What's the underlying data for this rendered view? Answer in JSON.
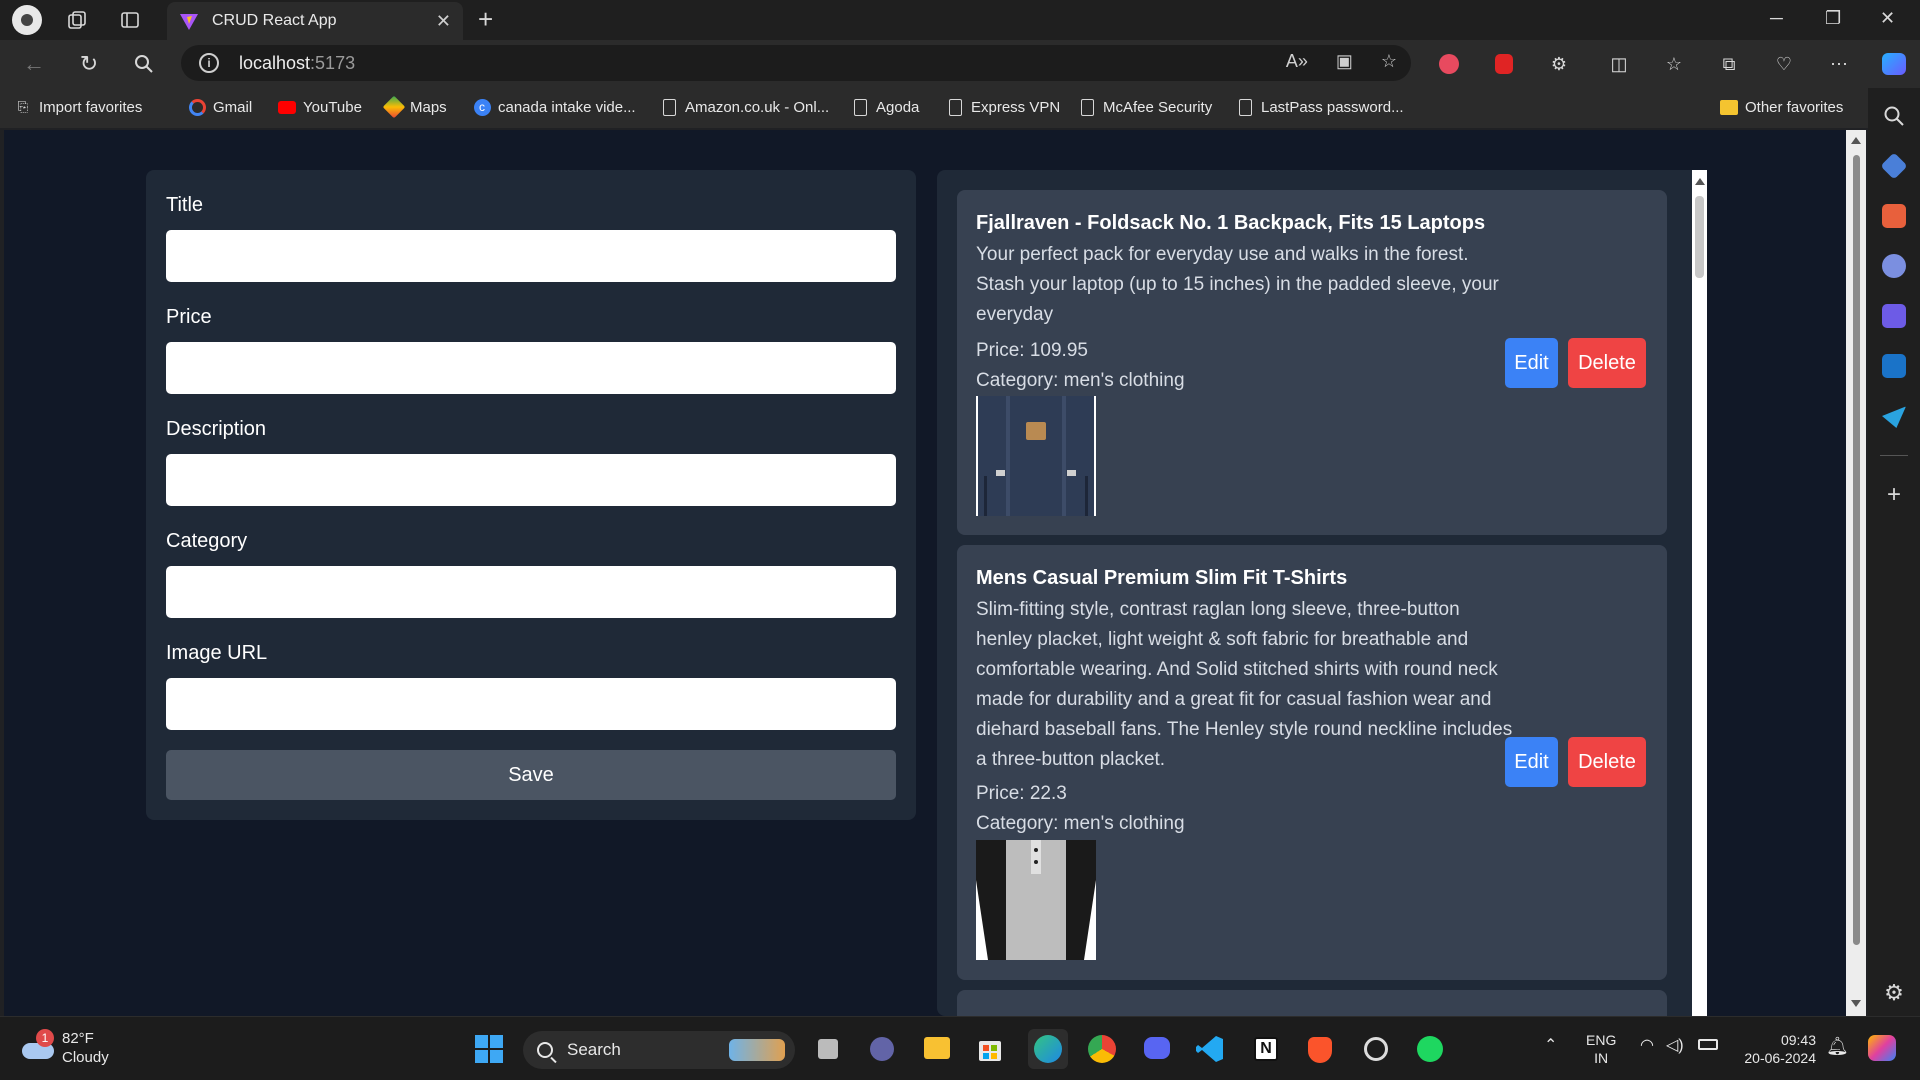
{
  "browser": {
    "tab_title": "CRUD React App",
    "url_host": "localhost",
    "url_port": ":5173"
  },
  "favorites": {
    "import": "Import favorites",
    "items": [
      "Gmail",
      "YouTube",
      "Maps",
      "canada intake vide...",
      "Amazon.co.uk - Onl...",
      "Agoda",
      "Express VPN",
      "McAfee Security",
      "LastPass password..."
    ],
    "other": "Other favorites"
  },
  "form": {
    "title_label": "Title",
    "price_label": "Price",
    "description_label": "Description",
    "category_label": "Category",
    "image_label": "Image URL",
    "title_value": "",
    "price_value": "",
    "description_value": "",
    "category_value": "",
    "image_value": "",
    "save_label": "Save"
  },
  "products": [
    {
      "title": "Fjallraven - Foldsack No. 1 Backpack, Fits 15 Laptops",
      "description": "Your perfect pack for everyday use and walks in the forest. Stash your laptop (up to 15 inches) in the padded sleeve, your everyday",
      "price": "Price: 109.95",
      "category": "Category: men's clothing",
      "edit_label": "Edit",
      "delete_label": "Delete"
    },
    {
      "title": "Mens Casual Premium Slim Fit T-Shirts",
      "description": "Slim-fitting style, contrast raglan long sleeve, three-button henley placket, light weight & soft fabric for breathable and comfortable wearing. And Solid stitched shirts with round neck made for durability and a great fit for casual fashion wear and diehard baseball fans. The Henley style round neckline includes a three-button placket.",
      "price": "Price: 22.3",
      "category": "Category: men's clothing",
      "edit_label": "Edit",
      "delete_label": "Delete"
    }
  ],
  "taskbar": {
    "temperature": "82°F",
    "weather": "Cloudy",
    "weather_badge": "1",
    "search_label": "Search",
    "lang_top": "ENG",
    "lang_bottom": "IN",
    "time": "09:43",
    "date": "20-06-2024"
  },
  "colors": {
    "page_bg": "#111827",
    "panel_bg": "#1f2937",
    "card_bg": "#374151",
    "save_bg": "#4b5563",
    "edit_bg": "#3b82f6",
    "delete_bg": "#ef4444"
  },
  "icons": {
    "browser": [
      "profile-icon",
      "workspaces-icon",
      "tab-actions-icon",
      "new-tab-icon",
      "back-icon",
      "refresh-icon",
      "search-icon",
      "read-aloud-icon",
      "immersive-reader-icon",
      "favorite-star-icon",
      "extensions-icon",
      "split-screen-icon",
      "favorites-icon",
      "collections-icon",
      "performance-icon",
      "more-icon",
      "copilot-icon"
    ],
    "taskbar": [
      "start-icon",
      "task-view-icon",
      "teams-icon",
      "file-explorer-icon",
      "store-icon",
      "edge-icon",
      "chrome-icon",
      "discord-icon",
      "vscode-icon",
      "notion-icon",
      "brave-icon",
      "obs-icon",
      "spotify-icon"
    ]
  }
}
